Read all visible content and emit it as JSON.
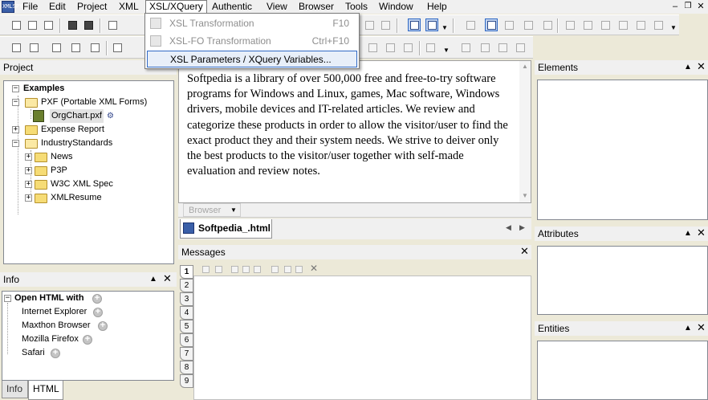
{
  "app": {
    "icon_text": "XMLSPY"
  },
  "menubar": {
    "items": [
      "File",
      "Edit",
      "Project",
      "XML",
      "XSL/XQuery",
      "Authentic",
      "View",
      "Browser",
      "Tools",
      "Window",
      "Help"
    ],
    "active": "XSL/XQuery"
  },
  "dropdown": {
    "items": [
      {
        "label": "XSL Transformation",
        "shortcut": "F10",
        "enabled": false
      },
      {
        "label": "XSL-FO Transformation",
        "shortcut": "Ctrl+F10",
        "enabled": false
      },
      {
        "label": "XSL Parameters / XQuery Variables...",
        "shortcut": "",
        "enabled": true
      }
    ]
  },
  "project_panel": {
    "title": "Project",
    "tree": {
      "root": "Examples",
      "nodes": [
        {
          "label": "PXF (Portable XML Forms)"
        },
        {
          "label": "OrgChart.pxf"
        },
        {
          "label": "Expense Report"
        },
        {
          "label": "IndustryStandards"
        },
        {
          "label": "News"
        },
        {
          "label": "P3P"
        },
        {
          "label": "W3C XML Spec"
        },
        {
          "label": "XMLResume"
        }
      ]
    }
  },
  "info_panel": {
    "title": "Info",
    "heading": "Open HTML with",
    "browsers": [
      "Internet Explorer",
      "Maxthon Browser",
      "Mozilla Firefox",
      "Safari"
    ],
    "tabs": [
      "Info",
      "HTML"
    ],
    "active_tab": "HTML"
  },
  "document": {
    "text": "Softpedia is a library of over 500,000 free and free-to-try software programs for Windows and Linux, games, Mac software, Windows drivers, mobile devices and IT-related articles. We review and categorize these products in order to allow the visitor/user to find the exact product they and their system needs. We strive to deiver only the best products to the visitor/user together with self-made evaluation and review notes.",
    "view_button": "Browser",
    "file_tab": "Softpedia_.html"
  },
  "messages_panel": {
    "title": "Messages",
    "tabs": [
      "1",
      "2",
      "3",
      "4",
      "5",
      "6",
      "7",
      "8",
      "9"
    ]
  },
  "right_panels": {
    "elements": "Elements",
    "attributes": "Attributes",
    "entities": "Entities"
  },
  "colors": {
    "chrome": "#f0f0f0",
    "highlight_border": "#316ac5",
    "highlight_fill": "#e8eff9"
  }
}
